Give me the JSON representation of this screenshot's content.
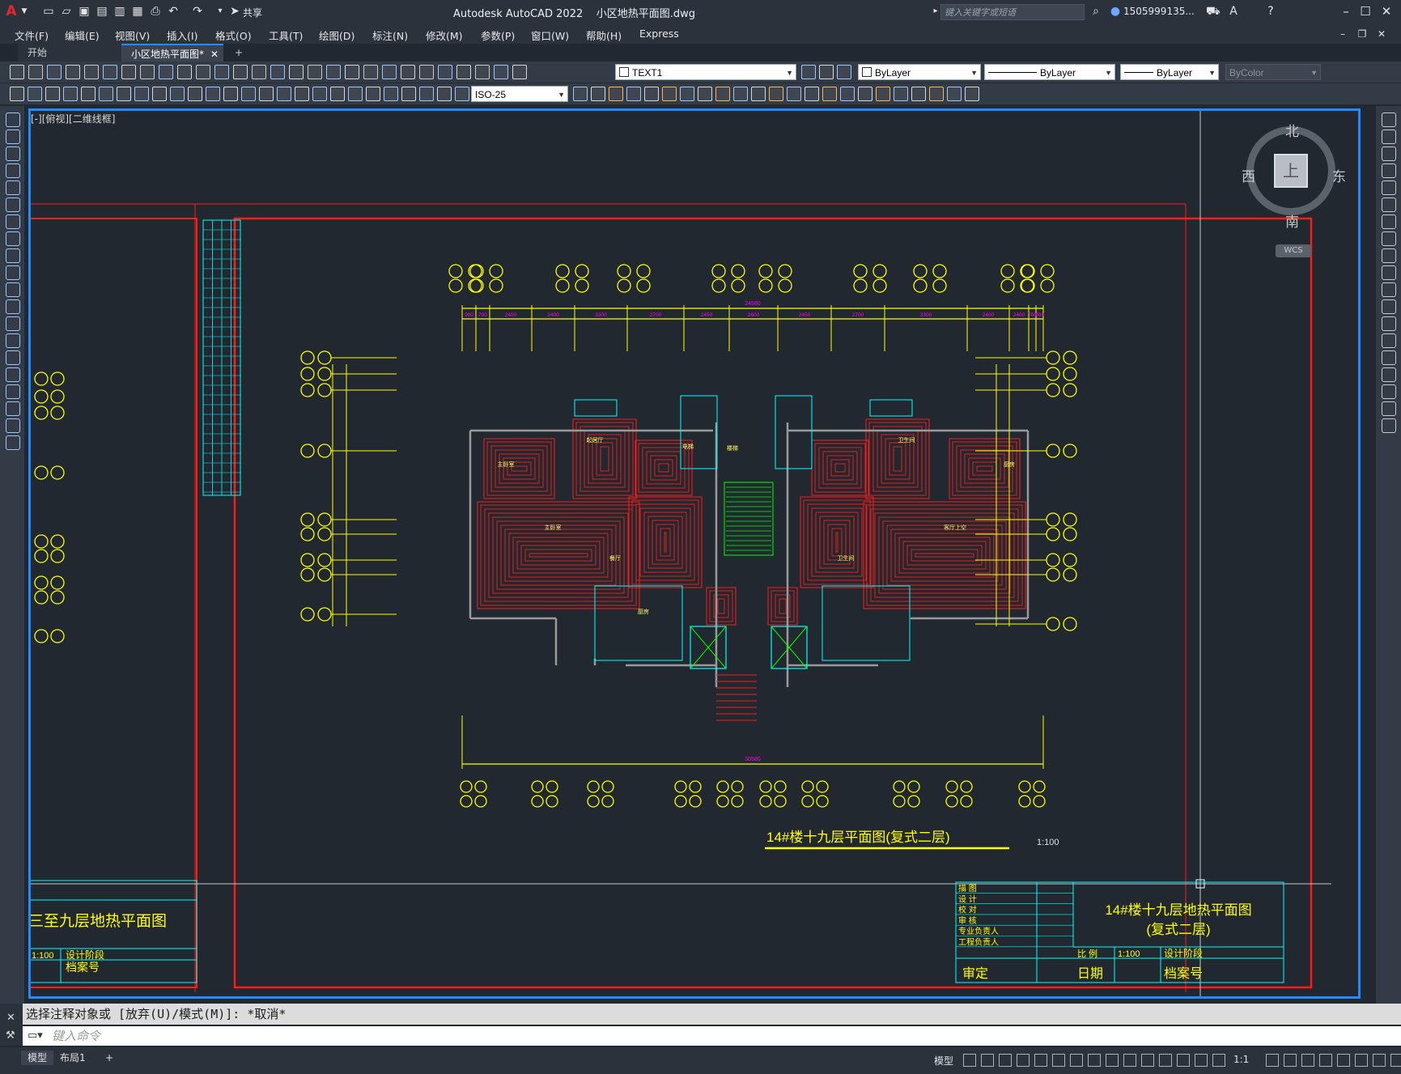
{
  "app": {
    "title": "Autodesk AutoCAD 2022    小区地热平面图.dwg",
    "search_placeholder": "键入关键字或短语",
    "user": "1505999135...",
    "share_label": "共享"
  },
  "menu": [
    "文件(F)",
    "编辑(E)",
    "视图(V)",
    "插入(I)",
    "格式(O)",
    "工具(T)",
    "绘图(D)",
    "标注(N)",
    "修改(M)",
    "参数(P)",
    "窗口(W)",
    "帮助(H)",
    "Express"
  ],
  "tabs": [
    {
      "label": "开始"
    },
    {
      "label": "小区地热平面图*"
    }
  ],
  "toolbar": {
    "layer": "TEXT1",
    "color": "ByLayer",
    "linetype": "ByLayer",
    "lineweight": "ByLayer",
    "plotstyle": "ByColor",
    "dimstyle": "ISO-25"
  },
  "viewport": {
    "label": "[-][俯视][二维线框]",
    "compass": {
      "north": "北",
      "south": "南",
      "east": "东",
      "west": "西",
      "top": "上",
      "wcs": "WCS"
    }
  },
  "drawing": {
    "main_title": "14#楼十九层平面图(复式二层)",
    "scale_note": "1:100",
    "left_sheet_title": "三至九层地热平面图",
    "left_scale": "1:100",
    "left_stage": "设计阶段",
    "left_archive": "档案号",
    "titleblock": {
      "rows": [
        "描  图",
        "设  计",
        "校  对",
        "审  核",
        "专业负责人",
        "工程负责人"
      ],
      "title_line1": "14#楼十九层地热平面图",
      "title_line2": "(复式二层)",
      "approve": "审定",
      "date": "日期",
      "ratio": "比 例",
      "ratio_value": "1:100",
      "stage": "设计阶段",
      "archive": "档案号"
    },
    "dim_top_total": "24580",
    "dim_top": [
      "900",
      "700",
      "2400",
      "2400",
      "3300",
      "2700",
      "2450",
      "2600",
      "2450",
      "2700",
      "3300",
      "2400",
      "2400",
      "700",
      "900"
    ],
    "dim_bottom_total": "30580",
    "rooms": [
      "主卧室",
      "主卧室",
      "起居厅",
      "餐厅",
      "厨房",
      "厨房",
      "客厅上空",
      "卫生间",
      "卫生间",
      "电梯",
      "楼梯"
    ]
  },
  "command": {
    "history": "选择注释对象或 [放弃(U)/模式(M)]: *取消*",
    "prompt": "键入命令"
  },
  "status": {
    "layouts": [
      "模型",
      "布局1"
    ],
    "model_label": "模型",
    "scale": "1:1"
  },
  "colors": {
    "wall_red": "#ff1a1a",
    "axis_yellow": "#ffff00",
    "cyan": "#00ffff",
    "magenta": "#ff00ff",
    "green": "#00ff00",
    "viewport_blue": "#1e8cff"
  }
}
